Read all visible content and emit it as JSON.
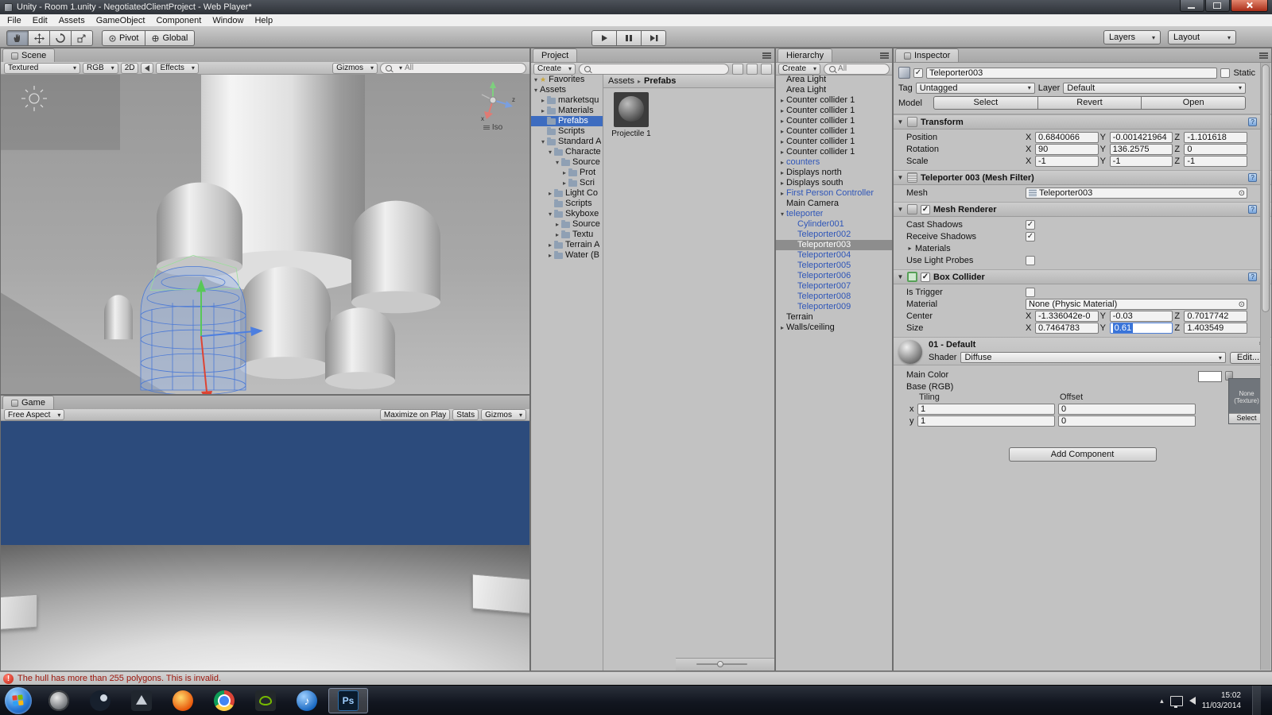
{
  "window": {
    "title": "Unity - Room 1.unity - NegotiatedClientProject - Web Player*",
    "menus": [
      "File",
      "Edit",
      "Assets",
      "GameObject",
      "Component",
      "Window",
      "Help"
    ]
  },
  "toolbar": {
    "pivot_label": "Pivot",
    "global_label": "Global",
    "layers_label": "Layers",
    "layout_label": "Layout"
  },
  "scene_panel": {
    "tab": "Scene",
    "shading_mode": "Textured",
    "rgb_mode": "RGB",
    "mode_2d": "2D",
    "effects_label": "Effects",
    "gizmos_label": "Gizmos",
    "search_value": "All",
    "view_gizmo_label": "Iso"
  },
  "game_panel": {
    "tab": "Game",
    "aspect": "Free Aspect",
    "maximize_label": "Maximize on Play",
    "stats_label": "Stats",
    "gizmos_label": "Gizmos"
  },
  "project_panel": {
    "tab": "Project",
    "create_label": "Create",
    "breadcrumb": {
      "root": "Assets",
      "current": "Prefabs"
    },
    "tree": [
      {
        "label": "Favorites",
        "depth": 0,
        "arrow": "open",
        "icon": "star"
      },
      {
        "label": "Assets",
        "depth": 0,
        "arrow": "open",
        "icon": "none"
      },
      {
        "label": "marketsqu",
        "depth": 1,
        "arrow": "closed",
        "icon": "folder"
      },
      {
        "label": "Materials",
        "depth": 1,
        "arrow": "closed",
        "icon": "folder"
      },
      {
        "label": "Prefabs",
        "depth": 1,
        "arrow": "none",
        "icon": "folder",
        "selected": true
      },
      {
        "label": "Scripts",
        "depth": 1,
        "arrow": "none",
        "icon": "folder"
      },
      {
        "label": "Standard A",
        "depth": 1,
        "arrow": "open",
        "icon": "folder"
      },
      {
        "label": "Characte",
        "depth": 2,
        "arrow": "open",
        "icon": "folder"
      },
      {
        "label": "Source",
        "depth": 3,
        "arrow": "open",
        "icon": "folder"
      },
      {
        "label": "Prot",
        "depth": 4,
        "arrow": "closed",
        "icon": "folder"
      },
      {
        "label": "Scri",
        "depth": 4,
        "arrow": "closed",
        "icon": "folder"
      },
      {
        "label": "Light Co",
        "depth": 2,
        "arrow": "closed",
        "icon": "folder"
      },
      {
        "label": "Scripts",
        "depth": 2,
        "arrow": "none",
        "icon": "folder"
      },
      {
        "label": "Skyboxe",
        "depth": 2,
        "arrow": "open",
        "icon": "folder"
      },
      {
        "label": "Source",
        "depth": 3,
        "arrow": "closed",
        "icon": "folder"
      },
      {
        "label": "Textu",
        "depth": 3,
        "arrow": "closed",
        "icon": "folder"
      },
      {
        "label": "Terrain A",
        "depth": 2,
        "arrow": "closed",
        "icon": "folder"
      },
      {
        "label": "Water (B",
        "depth": 2,
        "arrow": "closed",
        "icon": "folder"
      }
    ],
    "assets": [
      {
        "name": "Projectile 1"
      }
    ]
  },
  "hierarchy_panel": {
    "tab": "Hier",
    "tab_full": "Hierarchy",
    "create_label": "Create",
    "search_value": "All",
    "items": [
      {
        "label": "Area Light",
        "depth": 0,
        "arrow": "none"
      },
      {
        "label": "Area Light",
        "depth": 0,
        "arrow": "none"
      },
      {
        "label": "Counter collider 1",
        "depth": 0,
        "arrow": "closed"
      },
      {
        "label": "Counter collider 1",
        "depth": 0,
        "arrow": "closed"
      },
      {
        "label": "Counter collider 1",
        "depth": 0,
        "arrow": "closed"
      },
      {
        "label": "Counter collider 1",
        "depth": 0,
        "arrow": "closed"
      },
      {
        "label": "Counter collider 1",
        "depth": 0,
        "arrow": "closed"
      },
      {
        "label": "Counter collider 1",
        "depth": 0,
        "arrow": "closed"
      },
      {
        "label": "counters",
        "depth": 0,
        "arrow": "closed",
        "prefab": true
      },
      {
        "label": "Displays north",
        "depth": 0,
        "arrow": "closed"
      },
      {
        "label": "Displays south",
        "depth": 0,
        "arrow": "closed"
      },
      {
        "label": "First Person Controller",
        "depth": 0,
        "arrow": "closed",
        "prefab": true
      },
      {
        "label": "Main Camera",
        "depth": 0,
        "arrow": "none"
      },
      {
        "label": "teleporter",
        "depth": 0,
        "arrow": "open",
        "prefab": true
      },
      {
        "label": "Cylinder001",
        "depth": 1,
        "arrow": "none",
        "prefab": true
      },
      {
        "label": "Teleporter002",
        "depth": 1,
        "arrow": "none",
        "prefab": true
      },
      {
        "label": "Teleporter003",
        "depth": 1,
        "arrow": "none",
        "prefab": true,
        "selected": true
      },
      {
        "label": "Teleporter004",
        "depth": 1,
        "arrow": "none",
        "prefab": true
      },
      {
        "label": "Teleporter005",
        "depth": 1,
        "arrow": "none",
        "prefab": true
      },
      {
        "label": "Teleporter006",
        "depth": 1,
        "arrow": "none",
        "prefab": true
      },
      {
        "label": "Teleporter007",
        "depth": 1,
        "arrow": "none",
        "prefab": true
      },
      {
        "label": "Teleporter008",
        "depth": 1,
        "arrow": "none",
        "prefab": true
      },
      {
        "label": "Teleporter009",
        "depth": 1,
        "arrow": "none",
        "prefab": true
      },
      {
        "label": "Terrain",
        "depth": 0,
        "arrow": "none"
      },
      {
        "label": "Walls/ceiling",
        "depth": 0,
        "arrow": "closed"
      }
    ]
  },
  "inspector": {
    "tab": "Inspector",
    "axes": {
      "x": "X",
      "y": "Y",
      "z": "Z"
    },
    "header": {
      "active": true,
      "name": "Teleporter003",
      "static_label": "Static",
      "tag_label": "Tag",
      "tag_value": "Untagged",
      "layer_label": "Layer",
      "layer_value": "Default",
      "model_label": "Model",
      "model_buttons": [
        "Select",
        "Revert",
        "Open"
      ]
    },
    "transform": {
      "title": "Transform",
      "rows": [
        {
          "label": "Position",
          "x": "0.6840066",
          "y": "-0.001421964",
          "z": "-1.101618"
        },
        {
          "label": "Rotation",
          "x": "90",
          "y": "136.2575",
          "z": "0"
        },
        {
          "label": "Scale",
          "x": "-1",
          "y": "-1",
          "z": "-1"
        }
      ]
    },
    "mesh_filter": {
      "title": "Teleporter 003 (Mesh Filter)",
      "mesh_label": "Mesh",
      "mesh_value": "Teleporter003"
    },
    "mesh_renderer": {
      "title": "Mesh Renderer",
      "enabled": true,
      "cast_shadows_label": "Cast Shadows",
      "cast_shadows": true,
      "receive_shadows_label": "Receive Shadows",
      "receive_shadows": true,
      "materials_label": "Materials",
      "light_probes_label": "Use Light Probes",
      "light_probes": false
    },
    "box_collider": {
      "title": "Box Collider",
      "enabled": true,
      "is_trigger_label": "Is Trigger",
      "is_trigger": false,
      "material_label": "Material",
      "material_value": "None (Physic Material)",
      "center_label": "Center",
      "center": {
        "x": "-1.336042e-0",
        "y": "-0.03",
        "z": "0.7017742"
      },
      "size_label": "Size",
      "size": {
        "x": "0.7464783",
        "y": "0.61",
        "z": "1.403549"
      }
    },
    "material": {
      "name": "01 - Default",
      "shader_label": "Shader",
      "shader_value": "Diffuse",
      "edit_button": "Edit...",
      "main_color_label": "Main Color",
      "base_label": "Base (RGB)",
      "texture_none": "None (Texture)",
      "select_button": "Select",
      "tiling_label": "Tiling",
      "offset_label": "Offset",
      "row_x_label": "x",
      "row_y_label": "y",
      "tiling_x": "1",
      "tiling_y": "1",
      "offset_x": "0",
      "offset_y": "0"
    },
    "add_component": "Add Component"
  },
  "status_bar": {
    "error": "The hull has more than 255 polygons. This is invalid."
  },
  "taskbar": {
    "apps": [
      {
        "id": "gauge"
      },
      {
        "id": "steam"
      },
      {
        "id": "unity"
      },
      {
        "id": "firefox"
      },
      {
        "id": "chrome"
      },
      {
        "id": "nvidia"
      },
      {
        "id": "itunes"
      },
      {
        "id": "photoshop",
        "label": "Ps",
        "active": true
      }
    ],
    "time": "15:02",
    "date": "11/03/2014"
  }
}
